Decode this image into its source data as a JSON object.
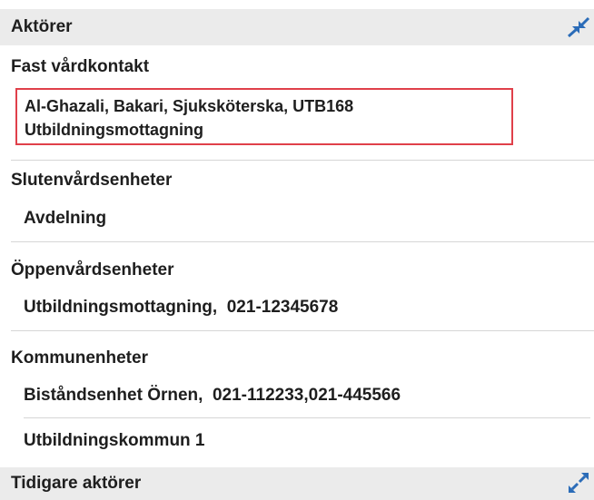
{
  "actors_panel": {
    "title": "Aktörer",
    "expand_icon": "collapse-arrows-icon",
    "fast_vardkontakt": {
      "label": "Fast vårdkontakt",
      "line1": "Al-Ghazali, Bakari, Sjuksköterska, UTB168",
      "line2": "Utbildningsmottagning",
      "highlight_color": "#e0404a"
    },
    "slutenvard": {
      "label": "Slutenvårdsenheter",
      "items": [
        "Avdelning"
      ]
    },
    "oppenvard": {
      "label": "Öppenvårdsenheter",
      "items": [
        "Utbildningsmottagning,  021-12345678"
      ]
    },
    "kommun": {
      "label": "Kommunenheter",
      "items": [
        "Biståndsenhet Örnen,  021-112233,021-445566",
        "Utbildningskommun 1"
      ]
    }
  },
  "previous_actors_panel": {
    "title": "Tidigare aktörer",
    "expand_icon": "expand-arrows-icon"
  }
}
